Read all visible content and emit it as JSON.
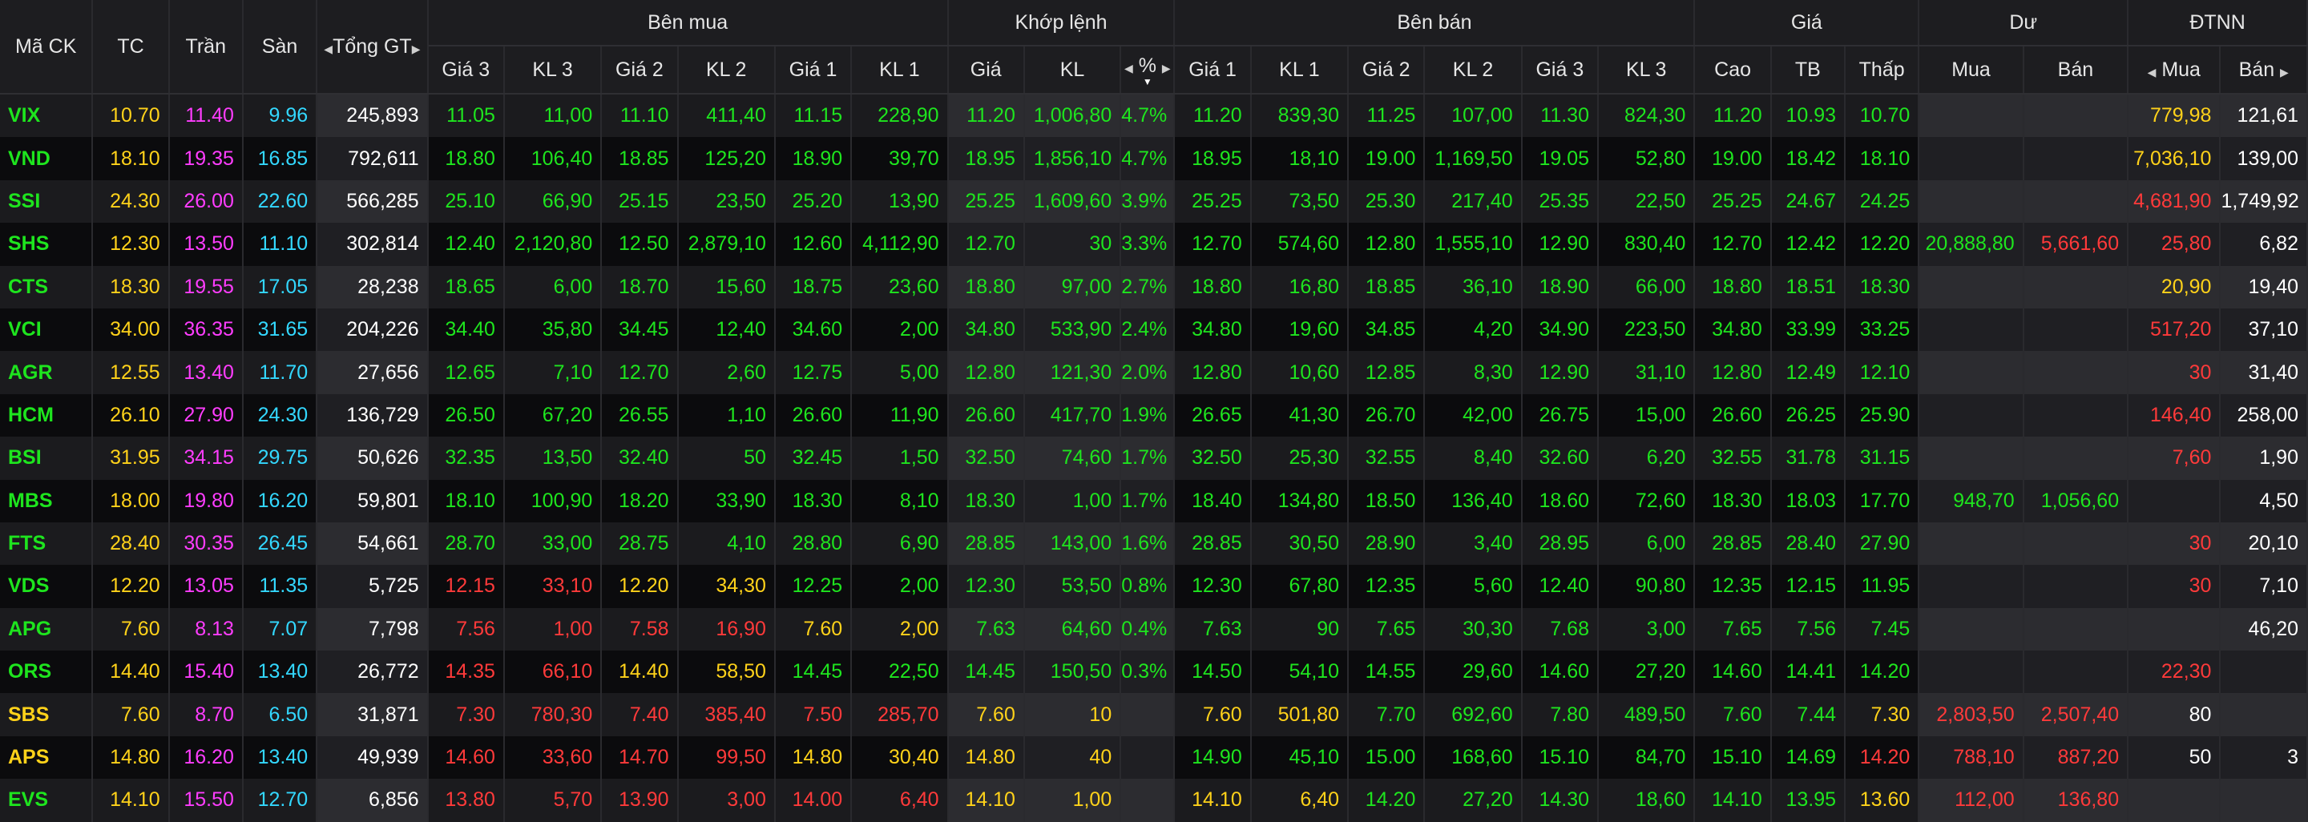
{
  "header": {
    "groups": {
      "ma_ck": "Mã CK",
      "tc": "TC",
      "tran": "Trần",
      "san": "Sàn",
      "tong_gt": "Tổng GT",
      "ben_mua": "Bên mua",
      "khop_lenh": "Khớp lệnh",
      "ben_ban": "Bên bán",
      "gia": "Giá",
      "du": "Dư",
      "dtnn": "ĐTNN"
    },
    "sub": {
      "bid_gia3": "Giá 3",
      "bid_kl3": "KL 3",
      "bid_gia2": "Giá 2",
      "bid_kl2": "KL 2",
      "bid_gia1": "Giá 1",
      "bid_kl1": "KL 1",
      "match_gia": "Giá",
      "match_kl": "KL",
      "match_pct": "%",
      "ask_gia1": "Giá 1",
      "ask_kl1": "KL 1",
      "ask_gia2": "Giá 2",
      "ask_kl2": "KL 2",
      "ask_gia3": "Giá 3",
      "ask_kl3": "KL 3",
      "cao": "Cao",
      "tb": "TB",
      "thap": "Thấp",
      "du_mua": "Mua",
      "du_ban": "Bán",
      "nn_mua": "Mua",
      "nn_ban": "Bán"
    }
  },
  "colors": {
    "green": "#1ee51e",
    "yellow": "#ffd21a",
    "red": "#ff3a3a",
    "ceiling": "#ff3dff",
    "floor": "#33d8ff",
    "white": "#ffffff"
  },
  "color_codes": {
    "g": "green",
    "y": "yellow",
    "r": "red",
    "p": "ceiling",
    "f": "floor",
    "w": "white"
  },
  "columns": [
    "sym",
    "tc",
    "tran",
    "san",
    "tong_gt",
    "bid_gia3",
    "bid_kl3",
    "bid_gia2",
    "bid_kl2",
    "bid_gia1",
    "bid_kl1",
    "match_gia",
    "match_kl",
    "match_pct",
    "ask_gia1",
    "ask_kl1",
    "ask_gia2",
    "ask_kl2",
    "ask_gia3",
    "ask_kl3",
    "cao",
    "tb",
    "thap",
    "du_mua",
    "du_ban",
    "nn_mua",
    "nn_ban"
  ],
  "rows": [
    {
      "sym": "VIX",
      "tc": "10.70",
      "tran": "11.40",
      "san": "9.96",
      "tong_gt": "245,893",
      "bid_gia3": "11.05",
      "bid_kl3": "11,00",
      "bid_gia2": "11.10",
      "bid_kl2": "411,40",
      "bid_gia1": "11.15",
      "bid_kl1": "228,90",
      "match_gia": "11.20",
      "match_kl": "1,006,80",
      "match_pct": "4.7%",
      "ask_gia1": "11.20",
      "ask_kl1": "839,30",
      "ask_gia2": "11.25",
      "ask_kl2": "107,00",
      "ask_gia3": "11.30",
      "ask_kl3": "824,30",
      "cao": "11.20",
      "tb": "10.93",
      "thap": "10.70",
      "du_mua": "",
      "du_ban": "",
      "nn_mua": "779,98",
      "nn_ban": "121,61",
      "colors": "gypfwgggggggggggggggggggyyww"
    },
    {
      "sym": "VND",
      "tc": "18.10",
      "tran": "19.35",
      "san": "16.85",
      "tong_gt": "792,611",
      "bid_gia3": "18.80",
      "bid_kl3": "106,40",
      "bid_gia2": "18.85",
      "bid_kl2": "125,20",
      "bid_gia1": "18.90",
      "bid_kl1": "39,70",
      "match_gia": "18.95",
      "match_kl": "1,856,10",
      "match_pct": "4.7%",
      "ask_gia1": "18.95",
      "ask_kl1": "18,10",
      "ask_gia2": "19.00",
      "ask_kl2": "1,169,50",
      "ask_gia3": "19.05",
      "ask_kl3": "52,80",
      "cao": "19.00",
      "tb": "18.42",
      "thap": "18.10",
      "du_mua": "",
      "du_ban": "",
      "nn_mua": "7,036,10",
      "nn_ban": "139,00",
      "colors": "gypfwgggggggggggggggggggyyww"
    },
    {
      "sym": "SSI",
      "tc": "24.30",
      "tran": "26.00",
      "san": "22.60",
      "tong_gt": "566,285",
      "bid_gia3": "25.10",
      "bid_kl3": "66,90",
      "bid_gia2": "25.15",
      "bid_kl2": "23,50",
      "bid_gia1": "25.20",
      "bid_kl1": "13,90",
      "match_gia": "25.25",
      "match_kl": "1,609,60",
      "match_pct": "3.9%",
      "ask_gia1": "25.25",
      "ask_kl1": "73,50",
      "ask_gia2": "25.30",
      "ask_kl2": "217,40",
      "ask_gia3": "25.35",
      "ask_kl3": "22,50",
      "cao": "25.25",
      "tb": "24.67",
      "thap": "24.25",
      "du_mua": "",
      "du_ban": "",
      "nn_mua": "4,681,90",
      "nn_ban": "1,749,92",
      "colors": "gypfwgggggggggggggggggggrrww"
    },
    {
      "sym": "SHS",
      "tc": "12.30",
      "tran": "13.50",
      "san": "11.10",
      "tong_gt": "302,814",
      "bid_gia3": "12.40",
      "bid_kl3": "2,120,80",
      "bid_gia2": "12.50",
      "bid_kl2": "2,879,10",
      "bid_gia1": "12.60",
      "bid_kl1": "4,112,90",
      "match_gia": "12.70",
      "match_kl": "30",
      "match_pct": "3.3%",
      "ask_gia1": "12.70",
      "ask_kl1": "574,60",
      "ask_gia2": "12.80",
      "ask_kl2": "1,555,10",
      "ask_gia3": "12.90",
      "ask_kl3": "830,40",
      "cao": "12.70",
      "tb": "12.42",
      "thap": "12.20",
      "du_mua": "20,888,80",
      "du_ban": "5,661,60",
      "nn_mua": "25,80",
      "nn_ban": "6,82",
      "colors": "gypfwgggggggggggggggggggrrww"
    },
    {
      "sym": "CTS",
      "tc": "18.30",
      "tran": "19.55",
      "san": "17.05",
      "tong_gt": "28,238",
      "bid_gia3": "18.65",
      "bid_kl3": "6,00",
      "bid_gia2": "18.70",
      "bid_kl2": "15,60",
      "bid_gia1": "18.75",
      "bid_kl1": "23,60",
      "match_gia": "18.80",
      "match_kl": "97,00",
      "match_pct": "2.7%",
      "ask_gia1": "18.80",
      "ask_kl1": "16,80",
      "ask_gia2": "18.85",
      "ask_kl2": "36,10",
      "ask_gia3": "18.90",
      "ask_kl3": "66,00",
      "cao": "18.80",
      "tb": "18.51",
      "thap": "18.30",
      "du_mua": "",
      "du_ban": "",
      "nn_mua": "20,90",
      "nn_ban": "19,40",
      "colors": "gypfwgggggggggggggggggggyyww"
    },
    {
      "sym": "VCI",
      "tc": "34.00",
      "tran": "36.35",
      "san": "31.65",
      "tong_gt": "204,226",
      "bid_gia3": "34.40",
      "bid_kl3": "35,80",
      "bid_gia2": "34.45",
      "bid_kl2": "12,40",
      "bid_gia1": "34.60",
      "bid_kl1": "2,00",
      "match_gia": "34.80",
      "match_kl": "533,90",
      "match_pct": "2.4%",
      "ask_gia1": "34.80",
      "ask_kl1": "19,60",
      "ask_gia2": "34.85",
      "ask_kl2": "4,20",
      "ask_gia3": "34.90",
      "ask_kl3": "223,50",
      "cao": "34.80",
      "tb": "33.99",
      "thap": "33.25",
      "du_mua": "",
      "du_ban": "",
      "nn_mua": "517,20",
      "nn_ban": "37,10",
      "colors": "gypfwggggggggggggggggggrrrww"
    },
    {
      "sym": "AGR",
      "tc": "12.55",
      "tran": "13.40",
      "san": "11.70",
      "tong_gt": "27,656",
      "bid_gia3": "12.65",
      "bid_kl3": "7,10",
      "bid_gia2": "12.70",
      "bid_kl2": "2,60",
      "bid_gia1": "12.75",
      "bid_kl1": "5,00",
      "match_gia": "12.80",
      "match_kl": "121,30",
      "match_pct": "2.0%",
      "ask_gia1": "12.80",
      "ask_kl1": "10,60",
      "ask_gia2": "12.85",
      "ask_kl2": "8,30",
      "ask_gia3": "12.90",
      "ask_kl3": "31,10",
      "cao": "12.80",
      "tb": "12.49",
      "thap": "12.10",
      "du_mua": "",
      "du_ban": "",
      "nn_mua": "30",
      "nn_ban": "31,40",
      "colors": "gypfwggggggggggggggggggrrrww"
    },
    {
      "sym": "HCM",
      "tc": "26.10",
      "tran": "27.90",
      "san": "24.30",
      "tong_gt": "136,729",
      "bid_gia3": "26.50",
      "bid_kl3": "67,20",
      "bid_gia2": "26.55",
      "bid_kl2": "1,10",
      "bid_gia1": "26.60",
      "bid_kl1": "11,90",
      "match_gia": "26.60",
      "match_kl": "417,70",
      "match_pct": "1.9%",
      "ask_gia1": "26.65",
      "ask_kl1": "41,30",
      "ask_gia2": "26.70",
      "ask_kl2": "42,00",
      "ask_gia3": "26.75",
      "ask_kl3": "15,00",
      "cao": "26.60",
      "tb": "26.25",
      "thap": "25.90",
      "du_mua": "",
      "du_ban": "",
      "nn_mua": "146,40",
      "nn_ban": "258,00",
      "colors": "gypfwgggggggggggggggggggrrww"
    },
    {
      "sym": "BSI",
      "tc": "31.95",
      "tran": "34.15",
      "san": "29.75",
      "tong_gt": "50,626",
      "bid_gia3": "32.35",
      "bid_kl3": "13,50",
      "bid_gia2": "32.40",
      "bid_kl2": "50",
      "bid_gia1": "32.45",
      "bid_kl1": "1,50",
      "match_gia": "32.50",
      "match_kl": "74,60",
      "match_pct": "1.7%",
      "ask_gia1": "32.50",
      "ask_kl1": "25,30",
      "ask_gia2": "32.55",
      "ask_kl2": "8,40",
      "ask_gia3": "32.60",
      "ask_kl3": "6,20",
      "cao": "32.55",
      "tb": "31.78",
      "thap": "31.15",
      "du_mua": "",
      "du_ban": "",
      "nn_mua": "7,60",
      "nn_ban": "1,90",
      "colors": "gypfwggggggggggggggggggrrrww"
    },
    {
      "sym": "MBS",
      "tc": "18.00",
      "tran": "19.80",
      "san": "16.20",
      "tong_gt": "59,801",
      "bid_gia3": "18.10",
      "bid_kl3": "100,90",
      "bid_gia2": "18.20",
      "bid_kl2": "33,90",
      "bid_gia1": "18.30",
      "bid_kl1": "8,10",
      "match_gia": "18.30",
      "match_kl": "1,00",
      "match_pct": "1.7%",
      "ask_gia1": "18.40",
      "ask_kl1": "134,80",
      "ask_gia2": "18.50",
      "ask_kl2": "136,40",
      "ask_gia3": "18.60",
      "ask_kl3": "72,60",
      "cao": "18.30",
      "tb": "18.03",
      "thap": "17.70",
      "du_mua": "948,70",
      "du_ban": "1,056,60",
      "nn_mua": "",
      "nn_ban": "4,50",
      "colors": "gypfwggggggggggggggggggggrww"
    },
    {
      "sym": "FTS",
      "tc": "28.40",
      "tran": "30.35",
      "san": "26.45",
      "tong_gt": "54,661",
      "bid_gia3": "28.70",
      "bid_kl3": "33,00",
      "bid_gia2": "28.75",
      "bid_kl2": "4,10",
      "bid_gia1": "28.80",
      "bid_kl1": "6,90",
      "match_gia": "28.85",
      "match_kl": "143,00",
      "match_pct": "1.6%",
      "ask_gia1": "28.85",
      "ask_kl1": "30,50",
      "ask_gia2": "28.90",
      "ask_kl2": "3,40",
      "ask_gia3": "28.95",
      "ask_kl3": "6,00",
      "cao": "28.85",
      "tb": "28.40",
      "thap": "27.90",
      "du_mua": "",
      "du_ban": "",
      "nn_mua": "30",
      "nn_ban": "20,10",
      "colors": "gypfwgggggggggggggggggggyrww"
    },
    {
      "sym": "VDS",
      "tc": "12.20",
      "tran": "13.05",
      "san": "11.35",
      "tong_gt": "5,725",
      "bid_gia3": "12.15",
      "bid_kl3": "33,10",
      "bid_gia2": "12.20",
      "bid_kl2": "34,30",
      "bid_gia1": "12.25",
      "bid_kl1": "2,00",
      "match_gia": "12.30",
      "match_kl": "53,50",
      "match_pct": "0.8%",
      "ask_gia1": "12.30",
      "ask_kl1": "67,80",
      "ask_gia2": "12.35",
      "ask_kl2": "5,60",
      "ask_gia3": "12.40",
      "ask_kl3": "90,80",
      "cao": "12.35",
      "tb": "12.15",
      "thap": "11.95",
      "du_mua": "",
      "du_ban": "",
      "nn_mua": "30",
      "nn_ban": "7,10",
      "colors": "gypfwrryyggggggggggggggrrrww"
    },
    {
      "sym": "APG",
      "tc": "7.60",
      "tran": "8.13",
      "san": "7.07",
      "tong_gt": "7,798",
      "bid_gia3": "7.56",
      "bid_kl3": "1,00",
      "bid_gia2": "7.58",
      "bid_kl2": "16,90",
      "bid_gia1": "7.60",
      "bid_kl1": "2,00",
      "match_gia": "7.63",
      "match_kl": "64,60",
      "match_pct": "0.4%",
      "ask_gia1": "7.63",
      "ask_kl1": "90",
      "ask_gia2": "7.65",
      "ask_kl2": "30,30",
      "ask_gia3": "7.68",
      "ask_kl3": "3,00",
      "cao": "7.65",
      "tb": "7.56",
      "thap": "7.45",
      "du_mua": "",
      "du_ban": "",
      "nn_mua": "",
      "nn_ban": "46,20",
      "colors": "gypfwrrrryyggggggggggggrrrww"
    },
    {
      "sym": "ORS",
      "tc": "14.40",
      "tran": "15.40",
      "san": "13.40",
      "tong_gt": "26,772",
      "bid_gia3": "14.35",
      "bid_kl3": "66,10",
      "bid_gia2": "14.40",
      "bid_kl2": "58,50",
      "bid_gia1": "14.45",
      "bid_kl1": "22,50",
      "match_gia": "14.45",
      "match_kl": "150,50",
      "match_pct": "0.3%",
      "ask_gia1": "14.50",
      "ask_kl1": "54,10",
      "ask_gia2": "14.55",
      "ask_kl2": "29,60",
      "ask_gia3": "14.60",
      "ask_kl3": "27,20",
      "cao": "14.60",
      "tb": "14.41",
      "thap": "14.20",
      "du_mua": "",
      "du_ban": "",
      "nn_mua": "22,30",
      "nn_ban": "",
      "colors": "gypfwrryyggggggggggggggggrww"
    },
    {
      "sym": "SBS",
      "tc": "7.60",
      "tran": "8.70",
      "san": "6.50",
      "tong_gt": "31,871",
      "bid_gia3": "7.30",
      "bid_kl3": "780,30",
      "bid_gia2": "7.40",
      "bid_kl2": "385,40",
      "bid_gia1": "7.50",
      "bid_kl1": "285,70",
      "match_gia": "7.60",
      "match_kl": "10",
      "match_pct": "",
      "ask_gia1": "7.60",
      "ask_kl1": "501,80",
      "ask_gia2": "7.70",
      "ask_kl2": "692,60",
      "ask_gia3": "7.80",
      "ask_kl3": "489,50",
      "cao": "7.60",
      "tb": "7.44",
      "thap": "7.30",
      "du_mua": "2,803,50",
      "du_ban": "2,507,40",
      "nn_mua": "80",
      "nn_ban": "",
      "colors": "yypfwrrrrrryywyyggggggyrrwww"
    },
    {
      "sym": "APS",
      "tc": "14.80",
      "tran": "16.20",
      "san": "13.40",
      "tong_gt": "49,939",
      "bid_gia3": "14.60",
      "bid_kl3": "33,60",
      "bid_gia2": "14.70",
      "bid_kl2": "99,50",
      "bid_gia1": "14.80",
      "bid_kl1": "30,40",
      "match_gia": "14.80",
      "match_kl": "40",
      "match_pct": "",
      "ask_gia1": "14.90",
      "ask_kl1": "45,10",
      "ask_gia2": "15.00",
      "ask_kl2": "168,60",
      "ask_gia3": "15.10",
      "ask_kl3": "84,70",
      "cao": "15.10",
      "tb": "14.69",
      "thap": "14.20",
      "du_mua": "788,10",
      "du_ban": "887,20",
      "nn_mua": "50",
      "nn_ban": "3",
      "colors": "yypfwrrrryyyywggggggggrrrwww"
    },
    {
      "sym": "EVS",
      "tc": "14.10",
      "tran": "15.50",
      "san": "12.70",
      "tong_gt": "6,856",
      "bid_gia3": "13.80",
      "bid_kl3": "5,70",
      "bid_gia2": "13.90",
      "bid_kl2": "3,00",
      "bid_gia1": "14.00",
      "bid_kl1": "6,40",
      "match_gia": "14.10",
      "match_kl": "1,00",
      "match_pct": "",
      "ask_gia1": "14.10",
      "ask_kl1": "6,40",
      "ask_gia2": "14.20",
      "ask_kl2": "27,20",
      "ask_gia3": "14.30",
      "ask_kl3": "18,60",
      "cao": "14.10",
      "tb": "13.95",
      "thap": "13.60",
      "du_mua": "112,00",
      "du_ban": "136,80",
      "nn_mua": "",
      "nn_ban": "",
      "colors": "gypfwrrrrrryywyyggggggyrrwww"
    }
  ]
}
